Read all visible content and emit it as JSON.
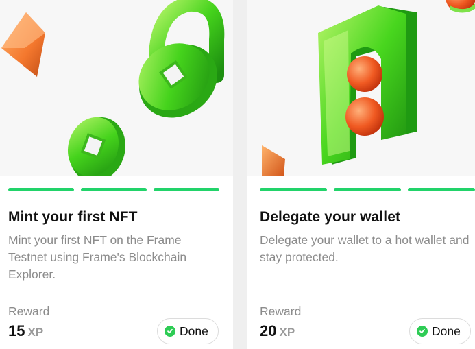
{
  "cards": [
    {
      "title": "Mint your first NFT",
      "description": "Mint your first NFT on the Frame Testnet using Frame's Blockchain Explorer.",
      "reward_label": "Reward",
      "reward_value": "15",
      "reward_unit": "XP",
      "status": "Done",
      "progress_segments": 3,
      "progress_completed": 3,
      "illustration": "green-padlock-and-coin"
    },
    {
      "title": "Delegate your wallet",
      "description": "Delegate your wallet to a hot wallet and stay protected.",
      "reward_label": "Reward",
      "reward_value": "20",
      "reward_unit": "XP",
      "status": "Done",
      "progress_segments": 3,
      "progress_completed": 3,
      "illustration": "green-arch-with-orange-spheres"
    }
  ],
  "colors": {
    "progress": "#22d36a",
    "check": "#2ecc55",
    "title": "#111111",
    "muted": "#8c8c8c",
    "green_object": "#45d31c",
    "orange_object": "#f06a2a"
  },
  "icons": {
    "status": "check-circle-icon"
  }
}
